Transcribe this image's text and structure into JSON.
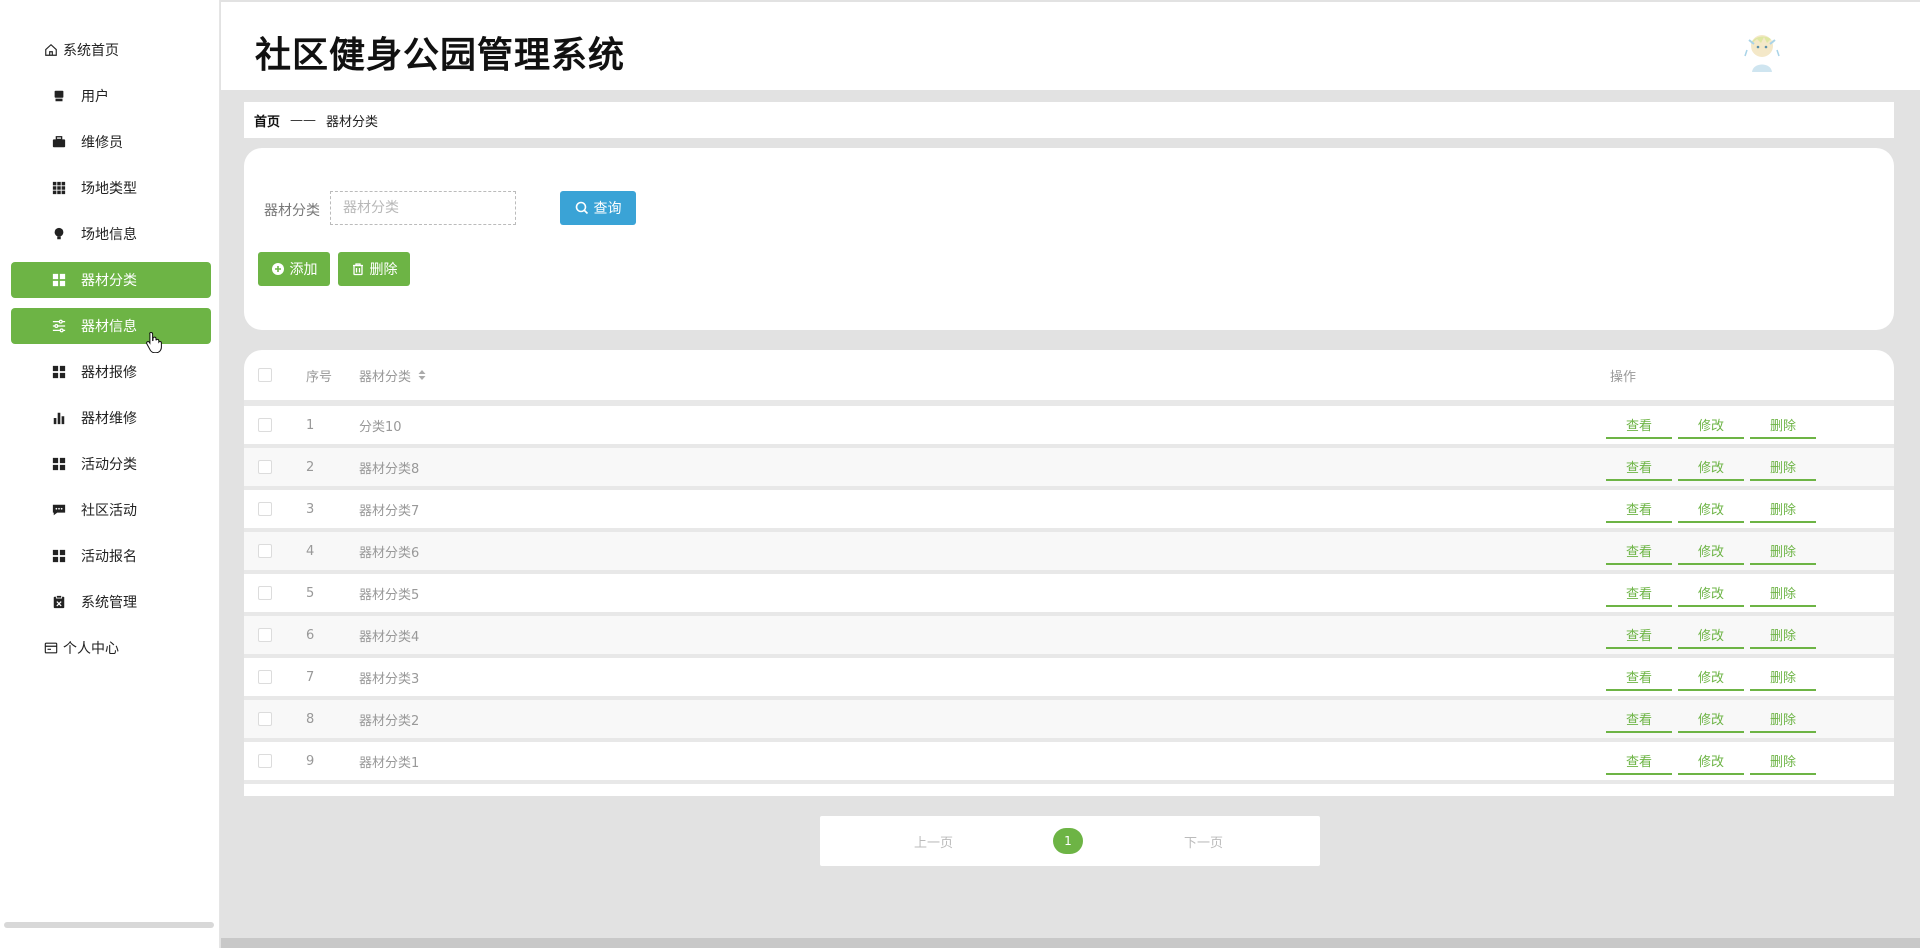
{
  "header": {
    "title": "社区健身公园管理系统"
  },
  "sidebar": {
    "items": [
      {
        "label": "系统首页",
        "icon": "home-icon",
        "active": false
      },
      {
        "label": "用户",
        "icon": "user-icon",
        "active": false
      },
      {
        "label": "维修员",
        "icon": "briefcase-icon",
        "active": false
      },
      {
        "label": "场地类型",
        "icon": "grid-icon",
        "active": false
      },
      {
        "label": "场地信息",
        "icon": "bulb-icon",
        "active": false
      },
      {
        "label": "器材分类",
        "icon": "dashboard-icon",
        "active": true
      },
      {
        "label": "器材信息",
        "icon": "sliders-icon",
        "active": true
      },
      {
        "label": "器材报修",
        "icon": "dashboard-icon",
        "active": false
      },
      {
        "label": "器材维修",
        "icon": "bar-chart-icon",
        "active": false
      },
      {
        "label": "活动分类",
        "icon": "dashboard-icon",
        "active": false
      },
      {
        "label": "社区活动",
        "icon": "comment-icon",
        "active": false
      },
      {
        "label": "活动报名",
        "icon": "dashboard-icon",
        "active": false
      },
      {
        "label": "系统管理",
        "icon": "clipboard-icon",
        "active": false
      },
      {
        "label": "个人中心",
        "icon": "card-icon",
        "active": false
      }
    ]
  },
  "breadcrumb": {
    "home": "首页",
    "separator": "——",
    "current": "器材分类"
  },
  "search": {
    "label": "器材分类",
    "placeholder": "器材分类",
    "value": "",
    "query_label": "查询"
  },
  "actions": {
    "add_label": "添加",
    "delete_label": "删除"
  },
  "table": {
    "headers": {
      "index": "序号",
      "name": "器材分类",
      "ops": "操作"
    },
    "op_labels": {
      "view": "查看",
      "edit": "修改",
      "delete": "删除"
    },
    "rows": [
      {
        "index": "1",
        "name": "分类10"
      },
      {
        "index": "2",
        "name": "器材分类8"
      },
      {
        "index": "3",
        "name": "器材分类7"
      },
      {
        "index": "4",
        "name": "器材分类6"
      },
      {
        "index": "5",
        "name": "器材分类5"
      },
      {
        "index": "6",
        "name": "器材分类4"
      },
      {
        "index": "7",
        "name": "器材分类3"
      },
      {
        "index": "8",
        "name": "器材分类2"
      },
      {
        "index": "9",
        "name": "器材分类1"
      }
    ]
  },
  "pagination": {
    "prev_label": "上一页",
    "current_page": "1",
    "next_label": "下一页"
  },
  "colors": {
    "accent": "#6db445",
    "query": "#3aa3d6"
  }
}
